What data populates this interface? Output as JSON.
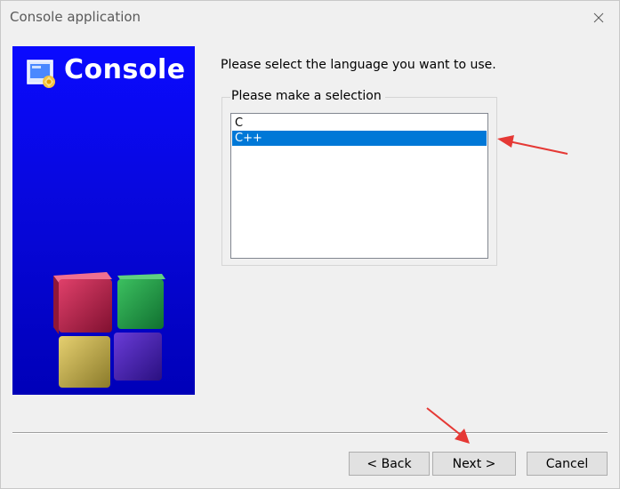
{
  "window": {
    "title": "Console application",
    "close_icon": "close-icon"
  },
  "banner": {
    "title": "Console",
    "logo_icon": "console-wizard-icon",
    "background": "#0808e0"
  },
  "content": {
    "prompt": "Please select the language you want to use.",
    "group_label": "Please make a selection",
    "languages": [
      {
        "label": "C",
        "selected": false
      },
      {
        "label": "C++",
        "selected": true
      }
    ]
  },
  "buttons": {
    "back": "< Back",
    "next": "Next >",
    "cancel": "Cancel"
  },
  "colors": {
    "selection": "#0078d7",
    "annotation_arrow": "#e53935"
  }
}
